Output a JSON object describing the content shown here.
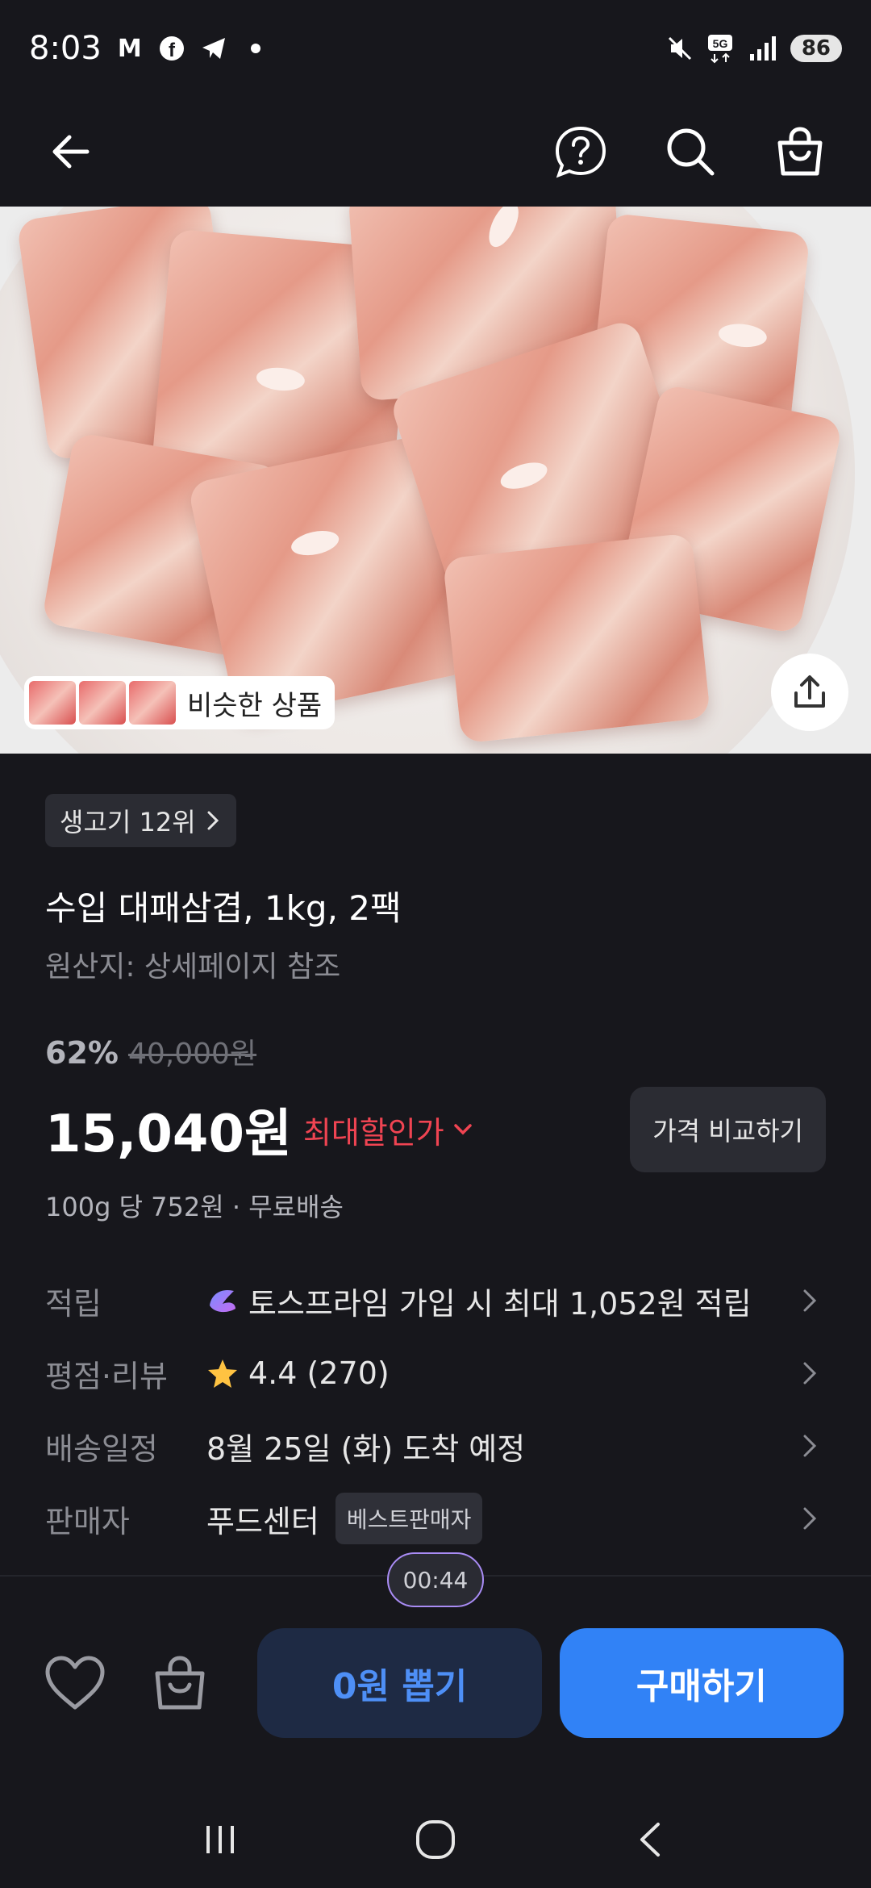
{
  "status_bar": {
    "time": "8:03",
    "left_icons": [
      "gmail-icon",
      "facebook-icon",
      "telegram-icon",
      "dot-icon"
    ],
    "right_icons": [
      "mute-icon",
      "5g-icon",
      "signal-icon"
    ],
    "battery": "86"
  },
  "app_bar": {
    "icons": [
      "back-arrow-icon",
      "help-icon",
      "search-icon",
      "shopping-bag-icon"
    ]
  },
  "hero": {
    "similar_label": "비슷한 상품",
    "share_icon": "share-icon"
  },
  "product": {
    "rank_chip": "생고기 12위",
    "title": "수입 대패삼겹, 1kg, 2팩",
    "origin": "원산지: 상세페이지 참조",
    "discount": "62%",
    "original_price": "40,000원",
    "price": "15,040원",
    "max_discount_label": "최대할인가",
    "compare_button": "가격 비교하기",
    "unit_info": "100g 당 752원 · 무료배송"
  },
  "info_rows": {
    "points_key": "적립",
    "points_val": "토스프라임 가입 시 최대 1,052원 적립",
    "rating_key": "평점·리뷰",
    "rating_val": "4.4 (270)",
    "delivery_key": "배송일정",
    "delivery_val": "8월 25일 (화) 도착 예정",
    "seller_key": "판매자",
    "seller_val": "푸드센터",
    "seller_badge": "베스트판매자"
  },
  "timer": "00:44",
  "bottom_bar": {
    "lottery_button": "0원 뽑기",
    "buy_button": "구매하기"
  },
  "colors": {
    "background": "#17171c",
    "accent_blue": "#3182f6",
    "discount_red": "#f04452"
  }
}
